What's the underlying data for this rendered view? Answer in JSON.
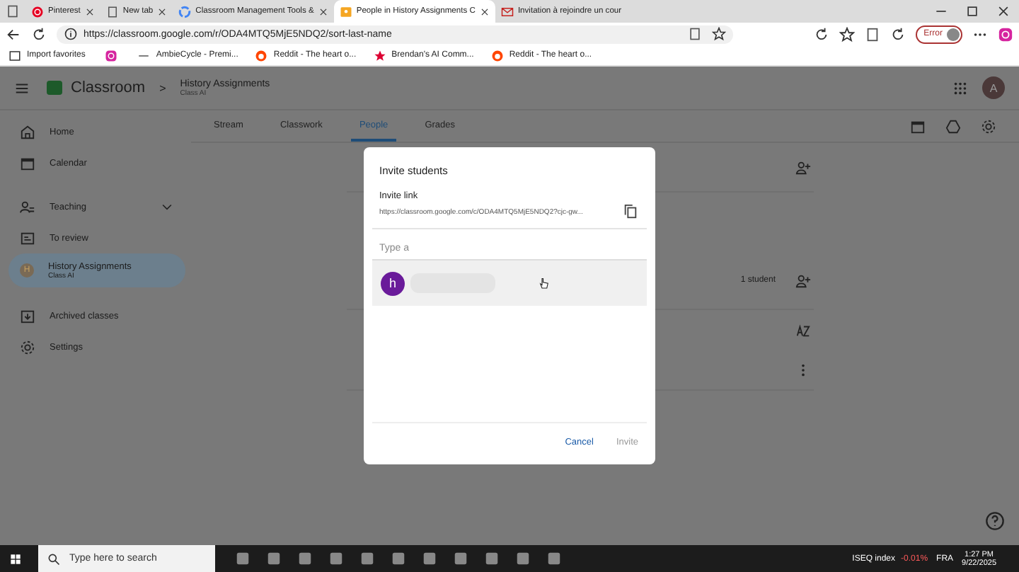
{
  "browser": {
    "tabs": [
      {
        "label": "Pinterest",
        "selected": false
      },
      {
        "label": "New tab",
        "selected": false
      },
      {
        "label": "Classroom Management Tools &",
        "selected": false
      },
      {
        "label": "People in History Assignments C",
        "selected": true
      },
      {
        "label": "Invitation à rejoindre un cour",
        "selected": false
      }
    ],
    "url": "https://classroom.google.com/r/ODA4MTQ5MjE5NDQ2/sort-last-name",
    "profile_badge": "Error",
    "bookmarks": [
      {
        "kind": "link",
        "label": "Import favorites"
      },
      {
        "kind": "icon"
      },
      {
        "kind": "link",
        "label": "AmbieCycle - Premi..."
      },
      {
        "kind": "link",
        "label": "Reddit - The heart o..."
      },
      {
        "kind": "link",
        "label": "Brendan's AI Comm..."
      },
      {
        "kind": "link",
        "label": "Reddit - The heart o..."
      }
    ]
  },
  "app": {
    "logo": "Classroom",
    "breadcrumb_separator": ">",
    "class_name": "History Assignments",
    "class_section": "Class AI",
    "avatar_letter": "A",
    "nav_tabs": [
      {
        "label": "Stream",
        "selected": false
      },
      {
        "label": "Classwork",
        "selected": false
      },
      {
        "label": "People",
        "selected": true
      },
      {
        "label": "Grades",
        "selected": false
      }
    ],
    "sidebar": [
      {
        "kind": "item",
        "label": "Home",
        "selected": false
      },
      {
        "kind": "item",
        "label": "Calendar",
        "selected": false
      },
      {
        "kind": "divider"
      },
      {
        "kind": "section",
        "label": "Teaching",
        "expanded": true
      },
      {
        "kind": "item",
        "label": "To review",
        "selected": false
      },
      {
        "kind": "class",
        "label": "History Assignments",
        "sublabel": "Class AI",
        "letter": "H",
        "selected": true
      },
      {
        "kind": "divider"
      },
      {
        "kind": "item",
        "label": "Archived classes",
        "selected": false
      },
      {
        "kind": "item",
        "label": "Settings",
        "selected": false
      }
    ],
    "students_count": "1 student"
  },
  "dialog": {
    "title": "Invite students",
    "link_label": "Invite link",
    "link": "https://classroom.google.com/c/ODA4MTQ5MjE5NDQ2?cjc-gw...",
    "placeholder": "Type a",
    "suggestion_letter": "h",
    "buttons": [
      {
        "label": "Cancel",
        "disabled": false
      },
      {
        "label": "Invite",
        "disabled": true
      }
    ]
  },
  "taskbar": {
    "search_placeholder": "Type here to search",
    "ticker": "ISEQ index",
    "ticker_change": "-0.01%",
    "language": "FRA",
    "time": "1:27 PM",
    "date": "9/22/2025"
  }
}
